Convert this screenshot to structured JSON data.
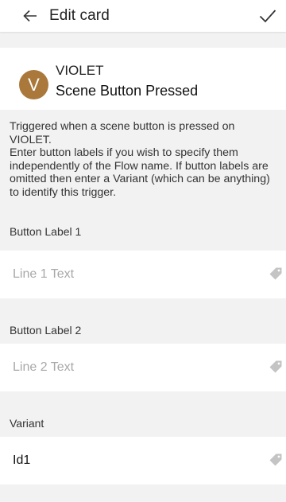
{
  "header": {
    "title": "Edit card",
    "back_icon": "arrow-left-icon",
    "confirm_icon": "check-icon"
  },
  "card": {
    "avatar_letter": "V",
    "avatar_color": "#a9783a",
    "device": "VIOLET",
    "trigger": "Scene Button Pressed"
  },
  "description": {
    "line1": "Triggered when a scene button is pressed on VIOLET.",
    "line2": "Enter button labels if you wish to specify them independently of the Flow name. If button labels are omitted then enter a Variant (which can be anything) to identify this trigger."
  },
  "fields": [
    {
      "label": "Button Label 1",
      "value": "",
      "placeholder": "Line 1 Text",
      "icon": "tag-icon"
    },
    {
      "label": "Button Label 2",
      "value": "",
      "placeholder": "Line 2 Text",
      "icon": "tag-icon"
    },
    {
      "label": "Variant",
      "value": "Id1",
      "placeholder": "",
      "icon": "tag-icon"
    }
  ]
}
